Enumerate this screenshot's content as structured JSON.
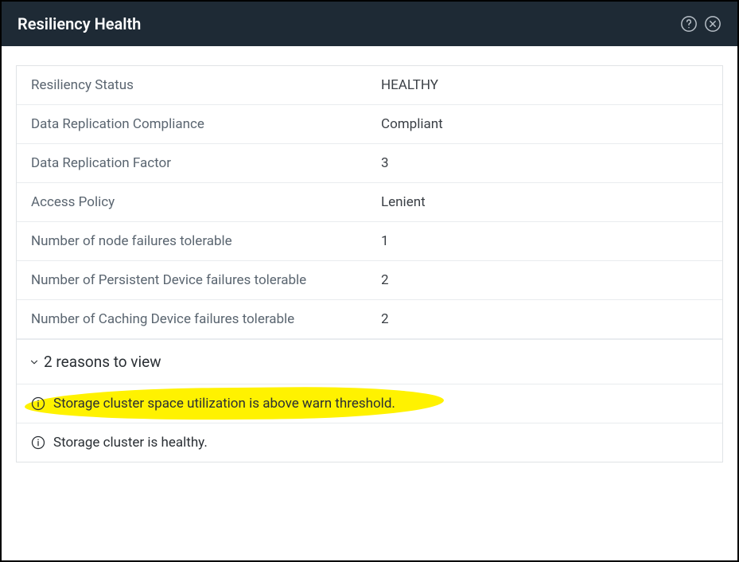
{
  "header": {
    "title": "Resiliency Health"
  },
  "rows": [
    {
      "label": "Resiliency Status",
      "value": "HEALTHY"
    },
    {
      "label": "Data Replication Compliance",
      "value": "Compliant"
    },
    {
      "label": "Data Replication Factor",
      "value": "3"
    },
    {
      "label": "Access Policy",
      "value": "Lenient"
    },
    {
      "label": "Number of node failures tolerable",
      "value": "1"
    },
    {
      "label": "Number of Persistent Device failures tolerable",
      "value": "2"
    },
    {
      "label": "Number of Caching Device failures tolerable",
      "value": "2"
    }
  ],
  "expand": {
    "label": "2 reasons to view"
  },
  "reasons": [
    {
      "text": "Storage cluster space utilization is above warn threshold.",
      "highlighted": true
    },
    {
      "text": "Storage cluster is healthy.",
      "highlighted": false
    }
  ]
}
